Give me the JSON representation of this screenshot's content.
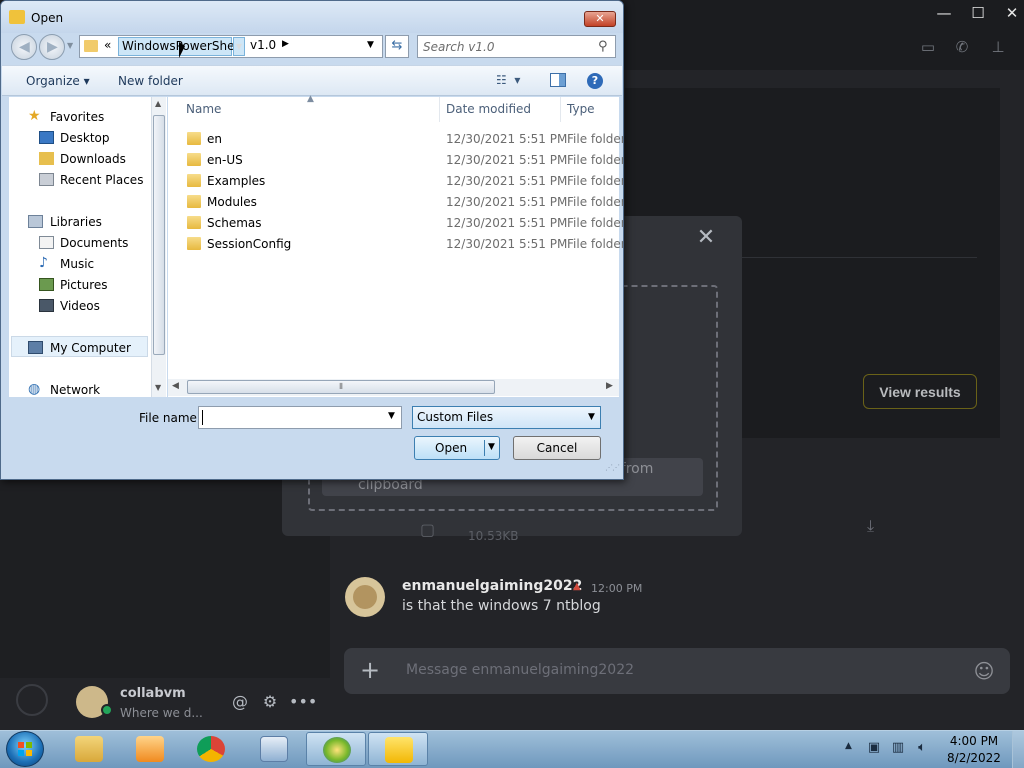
{
  "dialog": {
    "title": "Open",
    "address": {
      "chevron": "«",
      "crumbs": [
        "WindowsPowerShell",
        "v1.0"
      ]
    },
    "search": {
      "placeholder": "Search v1.0"
    },
    "toolbar": {
      "organize": "Organize ▾",
      "new_folder": "New folder",
      "help": "?"
    },
    "nav": {
      "favorites": "Favorites",
      "desktop": "Desktop",
      "downloads": "Downloads",
      "recent_places": "Recent Places",
      "libraries": "Libraries",
      "documents": "Documents",
      "music": "Music",
      "pictures": "Pictures",
      "videos": "Videos",
      "my_computer": "My Computer",
      "network": "Network"
    },
    "columns": {
      "name": "Name",
      "date_modified": "Date modified",
      "type": "Type"
    },
    "files": [
      {
        "name": "en",
        "date": "12/30/2021 5:51 PM",
        "type": "File folder"
      },
      {
        "name": "en-US",
        "date": "12/30/2021 5:51 PM",
        "type": "File folder"
      },
      {
        "name": "Examples",
        "date": "12/30/2021 5:51 PM",
        "type": "File folder"
      },
      {
        "name": "Modules",
        "date": "12/30/2021 5:51 PM",
        "type": "File folder"
      },
      {
        "name": "Schemas",
        "date": "12/30/2021 5:51 PM",
        "type": "File folder"
      },
      {
        "name": "SessionConfig",
        "date": "12/30/2021 5:51 PM",
        "type": "File folder"
      }
    ],
    "file_name_label": "File name:",
    "file_name_value": "",
    "file_type": "Custom Files",
    "open_label": "Open",
    "cancel_label": "Cancel"
  },
  "app": {
    "view_results": "View results",
    "paste_hint": "Paste media or file here or anywhere from clipboard",
    "attachment_size": "10.53KB",
    "message": {
      "author": "enmanuelgaiming2022",
      "time": "12:00 PM",
      "text": "is that the windows 7 ntblog"
    },
    "composer_placeholder": "Message enmanuelgaiming2022",
    "user": {
      "name": "collabvm",
      "activity": "Where we d..."
    }
  },
  "taskbar": {
    "time": "4:00 PM",
    "date": "8/2/2022"
  },
  "colors": {
    "discord_bg": "#202225",
    "win7_dialog_frame": "#c8daee",
    "taskbar": "#6f98bd",
    "view_results_border": "#6a6218"
  },
  "icons": {
    "favorites": "star-icon",
    "downloads": "folder-icon",
    "music": "music-note-icon",
    "network": "globe-icon"
  }
}
